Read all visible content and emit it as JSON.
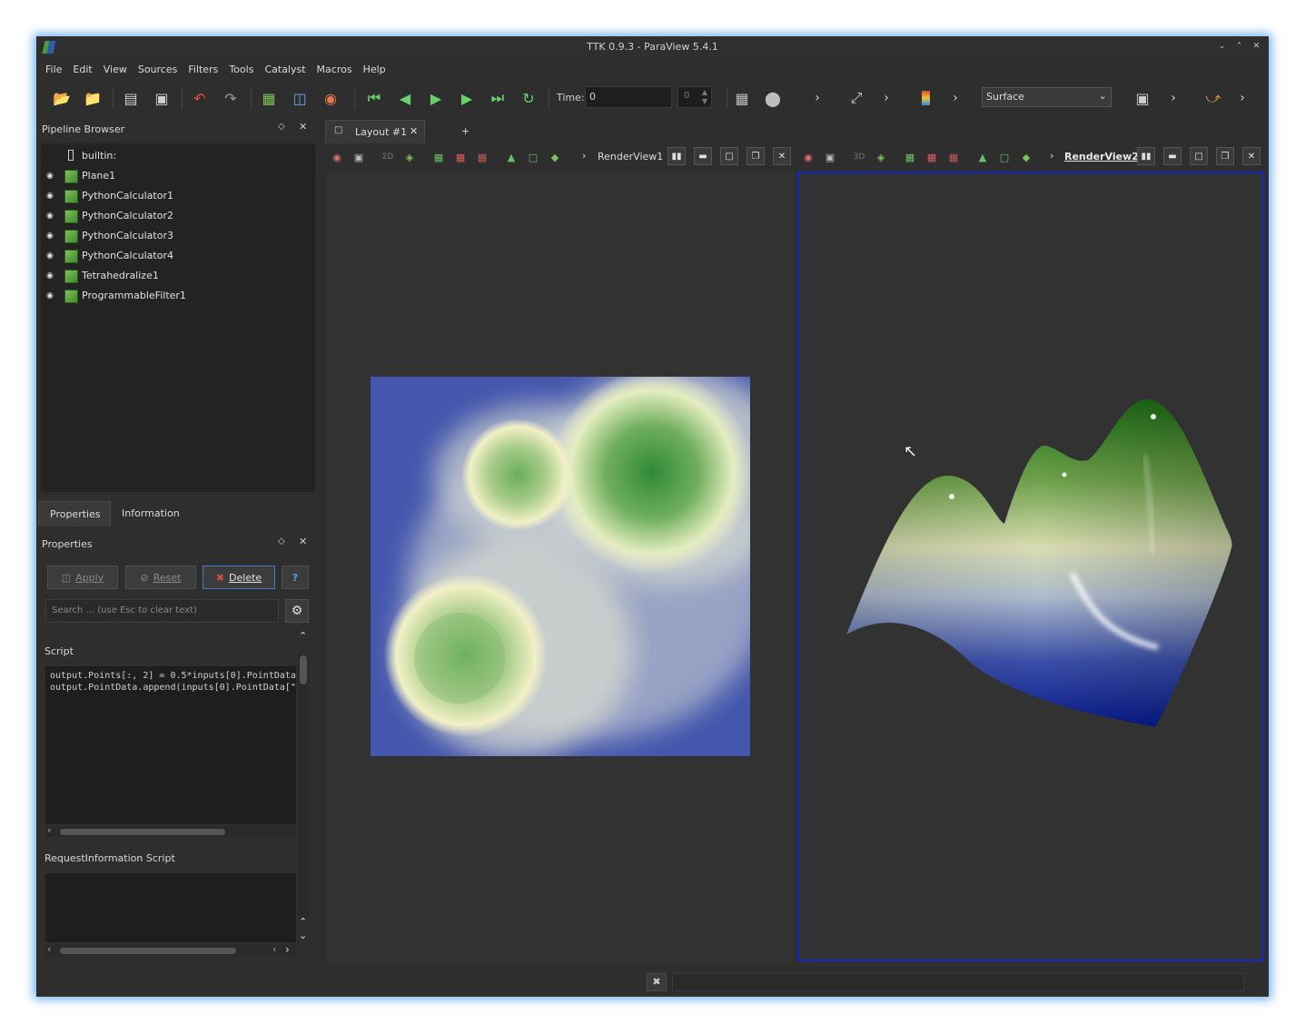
{
  "window": {
    "title": "TTK 0.9.3 - ParaView 5.4.1"
  },
  "menu": [
    "File",
    "Edit",
    "View",
    "Sources",
    "Filters",
    "Tools",
    "Catalyst",
    "Macros",
    "Help"
  ],
  "toolbar": {
    "time_label": "Time:",
    "time_value": "0",
    "timestep_value": "0",
    "representation": "Surface"
  },
  "pipeline": {
    "title": "Pipeline Browser",
    "items": [
      {
        "label": "builtin:",
        "visible": null
      },
      {
        "label": "Plane1",
        "visible": true
      },
      {
        "label": "PythonCalculator1",
        "visible": true
      },
      {
        "label": "PythonCalculator2",
        "visible": true
      },
      {
        "label": "PythonCalculator3",
        "visible": true
      },
      {
        "label": "PythonCalculator4",
        "visible": true
      },
      {
        "label": "Tetrahedralize1",
        "visible": true
      },
      {
        "label": "ProgrammableFilter1",
        "visible": true
      }
    ]
  },
  "tabs": {
    "properties": "Properties",
    "information": "Information"
  },
  "properties": {
    "title": "Properties",
    "apply": "Apply",
    "reset": "Reset",
    "delete": "Delete",
    "help": "?",
    "search_placeholder": "Search ... (use Esc to clear text)",
    "script_label": "Script",
    "script_line1": "output.Points[:, 2] = 0.5*inputs[0].PointData",
    "script_line2": "output.PointData.append(inputs[0].PointData[\"",
    "request_label": "RequestInformation Script"
  },
  "layout": {
    "tab": "Layout #1",
    "add": "+"
  },
  "views": {
    "view1": {
      "name": "RenderView1",
      "mode": "2D"
    },
    "view2": {
      "name": "RenderView2",
      "mode": "3D"
    }
  },
  "colors": {
    "accent": "#1228c8",
    "green": "#2f8a2f",
    "blue": "#0a1e8c",
    "cream": "#f4f2c8"
  }
}
